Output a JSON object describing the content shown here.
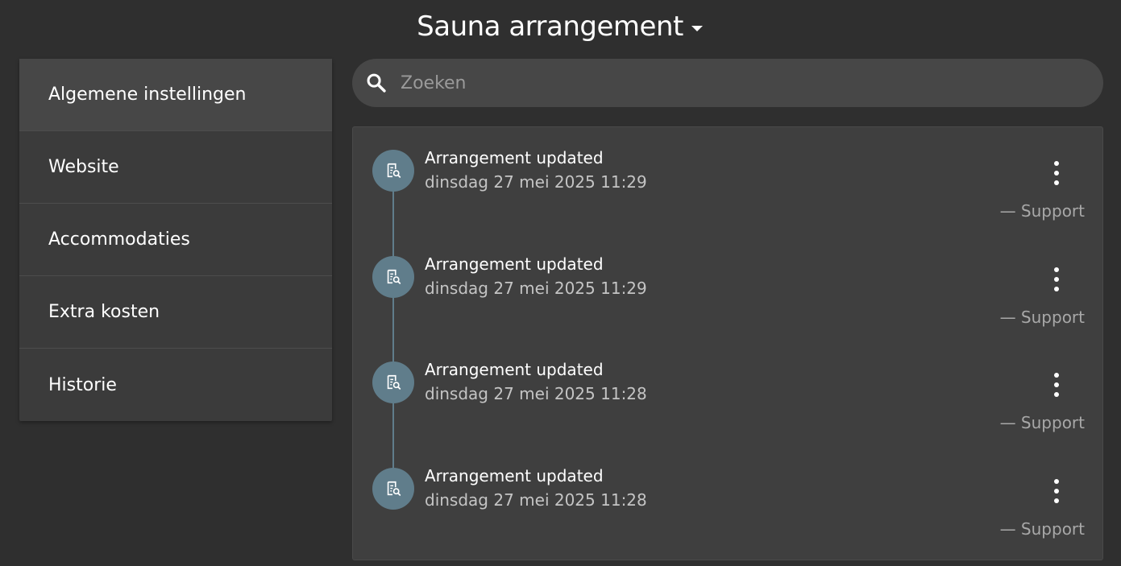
{
  "header": {
    "title": "Sauna arrangement"
  },
  "sidebar": {
    "items": [
      {
        "label": "Algemene instellingen",
        "active": true
      },
      {
        "label": "Website"
      },
      {
        "label": "Accommodaties"
      },
      {
        "label": "Extra kosten"
      },
      {
        "label": "Historie"
      }
    ]
  },
  "search": {
    "placeholder": "Zoeken",
    "value": ""
  },
  "timeline": {
    "entries": [
      {
        "title": "Arrangement updated",
        "date": "dinsdag 27 mei 2025 11:29",
        "author": "— Support"
      },
      {
        "title": "Arrangement updated",
        "date": "dinsdag 27 mei 2025 11:29",
        "author": "— Support"
      },
      {
        "title": "Arrangement updated",
        "date": "dinsdag 27 mei 2025 11:28",
        "author": "— Support"
      },
      {
        "title": "Arrangement updated",
        "date": "dinsdag 27 mei 2025 11:28",
        "author": "— Support"
      }
    ]
  },
  "icons": {
    "search": "search-icon",
    "entry": "document-search-icon",
    "menu": "more-vert-icon",
    "dropdown": "caret-down-icon"
  },
  "colors": {
    "background": "#2f2f2f",
    "timeline_accent": "#607d8b",
    "card": "#3f3f3f",
    "sidebar": "#3b3b3b"
  }
}
